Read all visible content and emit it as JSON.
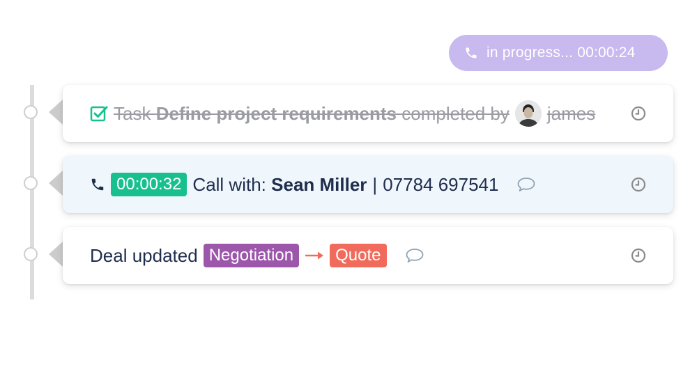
{
  "call_status": {
    "label": "in progress... 00:00:24",
    "icon": "phone-icon",
    "color": "#c8b9ef"
  },
  "timeline": {
    "task": {
      "prefix": "Task",
      "title": "Define project requirements",
      "suffix": "completed by",
      "user": "james",
      "icon": "checkbox-checked-icon"
    },
    "call": {
      "duration": "00:00:32",
      "label": "Call with:",
      "contact": "Sean Miller",
      "separator": "|",
      "phone": "07784 697541"
    },
    "deal": {
      "label": "Deal updated",
      "from_stage": "Negotiation",
      "to_stage": "Quote"
    }
  },
  "colors": {
    "green": "#17c08e",
    "purple": "#9c57ab",
    "red": "#f06b5b",
    "text": "#1f2d4d"
  }
}
